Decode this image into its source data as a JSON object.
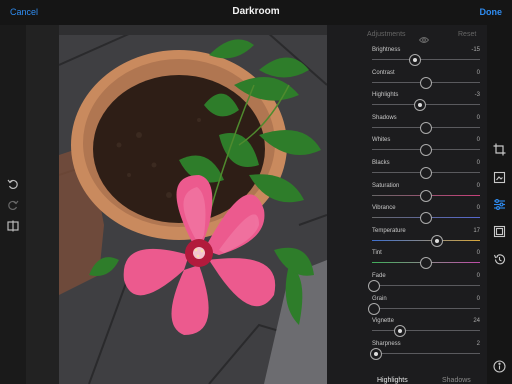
{
  "header": {
    "cancel": "Cancel",
    "title": "Darkroom",
    "done": "Done"
  },
  "panel": {
    "tab_adjustments": "Adjustments",
    "reset": "Reset",
    "sliders": [
      {
        "label": "Brightness",
        "value": "-15",
        "level": 0.4
      },
      {
        "label": "Contrast",
        "value": "0",
        "level": 0.5
      },
      {
        "label": "Highlights",
        "value": "-3",
        "level": 0.44
      },
      {
        "label": "Shadows",
        "value": "0",
        "level": 0.5
      },
      {
        "label": "Whites",
        "value": "0",
        "level": 0.5
      },
      {
        "label": "Blacks",
        "value": "0",
        "level": 0.5
      },
      {
        "label": "Saturation",
        "value": "0",
        "level": 0.5
      },
      {
        "label": "Vibrance",
        "value": "0",
        "level": 0.5
      },
      {
        "label": "Temperature",
        "value": "17",
        "level": 0.6
      },
      {
        "label": "Tint",
        "value": "0",
        "level": 0.5
      },
      {
        "label": "Fade",
        "value": "0",
        "level": 0.02
      },
      {
        "label": "Grain",
        "value": "0",
        "level": 0.02
      },
      {
        "label": "Vignette",
        "value": "24",
        "level": 0.26
      },
      {
        "label": "Sharpness",
        "value": "2",
        "level": 0.04
      }
    ],
    "bottom_tabs": [
      "Highlights",
      "Shadows"
    ]
  },
  "icons": {
    "left": [
      "undo-icon",
      "redo-icon",
      "compare-icon"
    ],
    "right": [
      "crop-icon",
      "frames-icon",
      "adjust-sliders-icon",
      "filters-icon",
      "history-icon",
      "info-icon"
    ]
  },
  "colors": {
    "accent": "#2f8cf0"
  }
}
